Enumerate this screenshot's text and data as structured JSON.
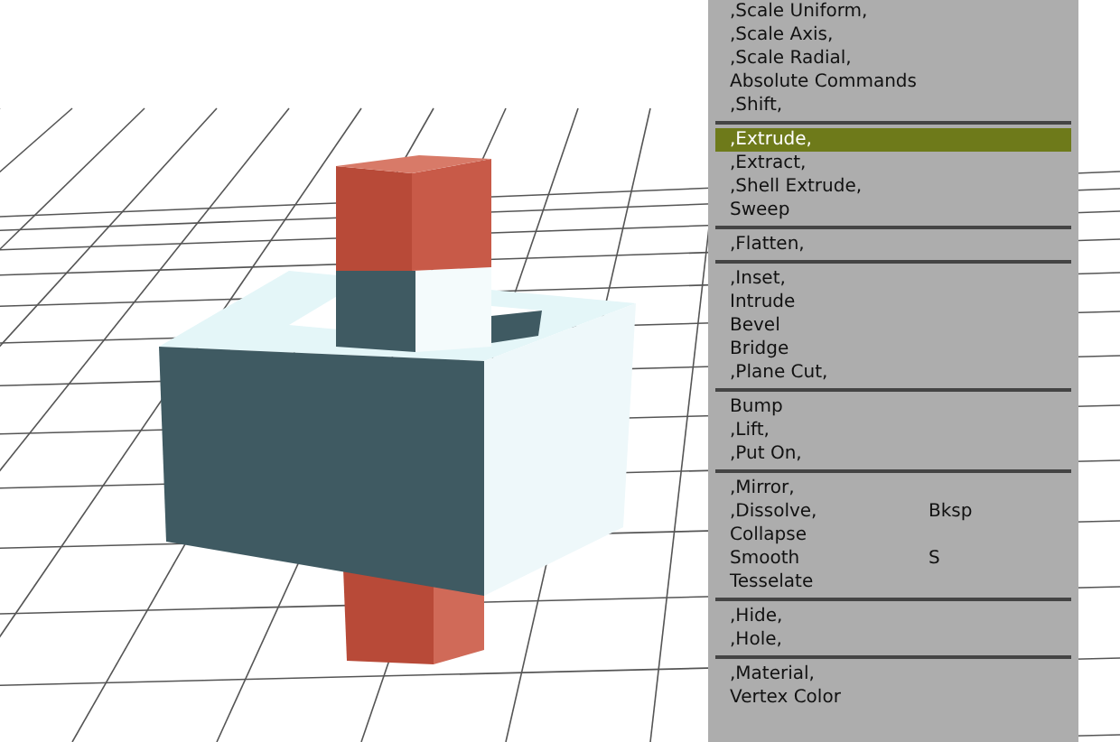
{
  "menu": {
    "groups": [
      {
        "items": [
          {
            "label": ",Scale Uniform,",
            "selected": false
          },
          {
            "label": ",Scale Axis,",
            "selected": false
          },
          {
            "label": ",Scale Radial,",
            "selected": false
          },
          {
            "label": "Absolute Commands",
            "selected": false
          },
          {
            "label": ",Shift,",
            "selected": false
          }
        ]
      },
      {
        "items": [
          {
            "label": ",Extrude,",
            "selected": true
          },
          {
            "label": ",Extract,",
            "selected": false
          },
          {
            "label": ",Shell Extrude,",
            "selected": false
          },
          {
            "label": "Sweep",
            "selected": false
          }
        ]
      },
      {
        "items": [
          {
            "label": ",Flatten,",
            "selected": false
          }
        ]
      },
      {
        "items": [
          {
            "label": ",Inset,",
            "selected": false
          },
          {
            "label": "Intrude",
            "selected": false
          },
          {
            "label": "Bevel",
            "selected": false
          },
          {
            "label": "Bridge",
            "selected": false
          },
          {
            "label": ",Plane Cut,",
            "selected": false
          }
        ]
      },
      {
        "items": [
          {
            "label": "Bump",
            "selected": false
          },
          {
            "label": ",Lift,",
            "selected": false
          },
          {
            "label": ",Put On,",
            "selected": false
          }
        ]
      },
      {
        "items": [
          {
            "label": ",Mirror,",
            "selected": false
          },
          {
            "label": ",Dissolve,",
            "shortcut": "Bksp",
            "selected": false
          },
          {
            "label": "Collapse",
            "selected": false
          },
          {
            "label": "Smooth",
            "shortcut": "S",
            "selected": false
          },
          {
            "label": "Tesselate",
            "selected": false
          }
        ]
      },
      {
        "items": [
          {
            "label": ",Hide,",
            "selected": false
          },
          {
            "label": ",Hole,",
            "selected": false
          }
        ]
      },
      {
        "items": [
          {
            "label": ",Material,",
            "selected": false
          },
          {
            "label": "Vertex Color",
            "selected": false
          }
        ]
      }
    ]
  }
}
